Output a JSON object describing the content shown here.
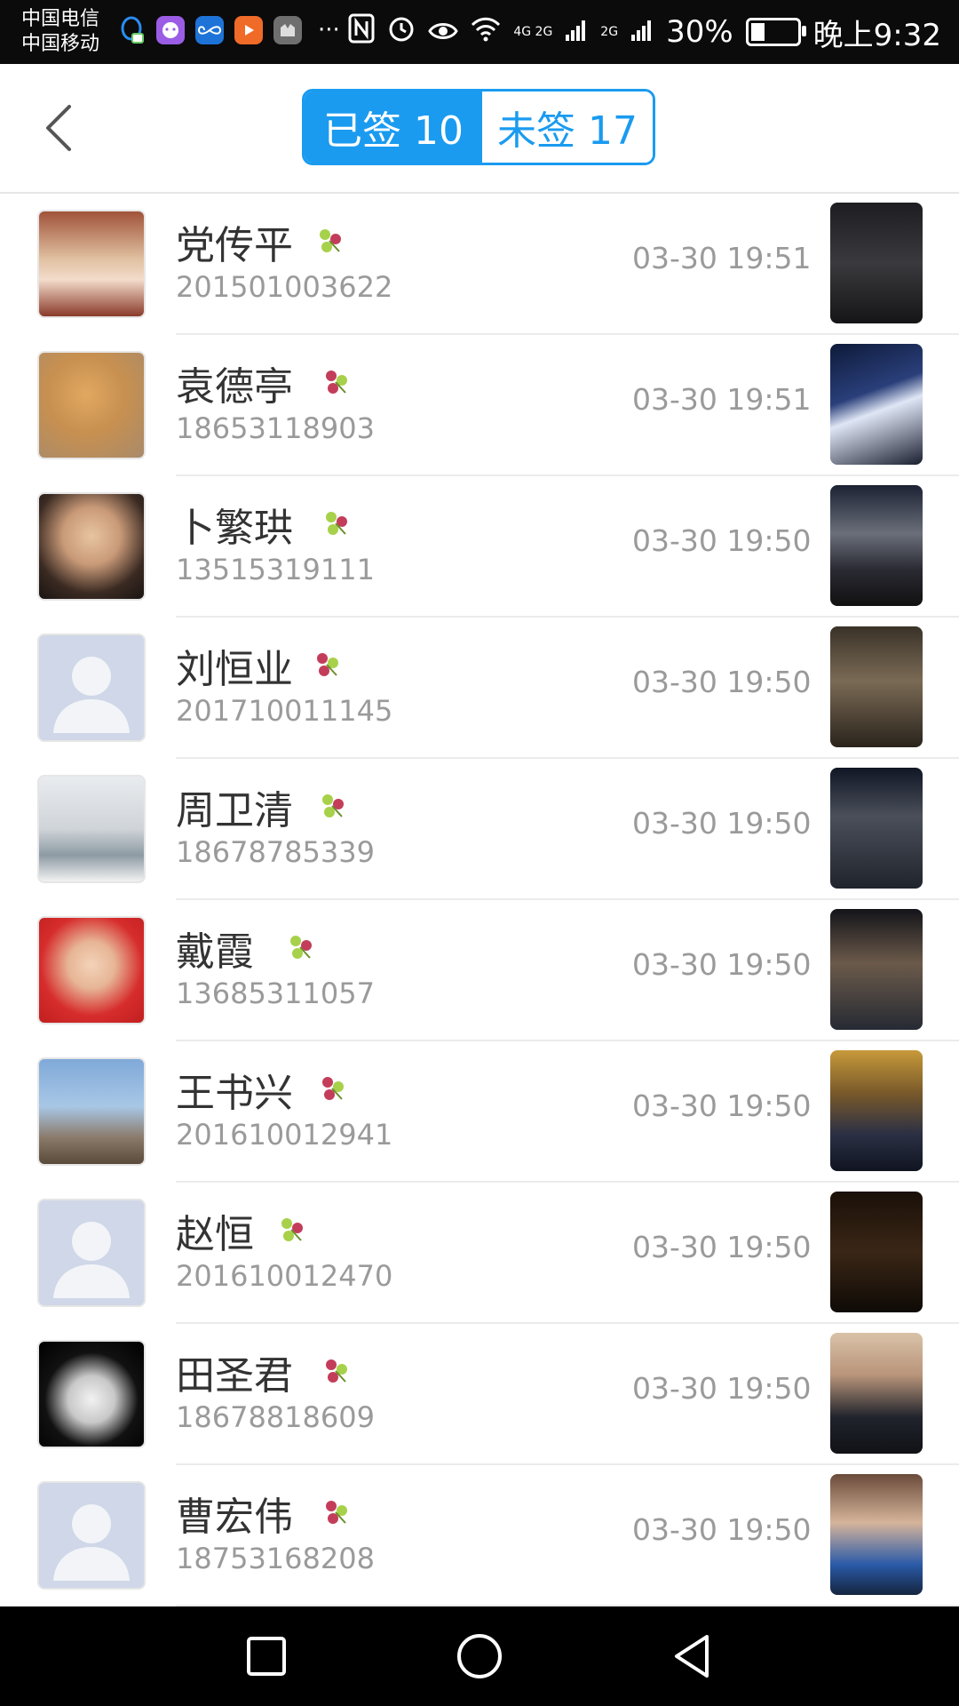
{
  "status_bar": {
    "carrier_1": "中国电信",
    "carrier_2": "中国移动",
    "apps": [
      "qq-icon",
      "messenger-icon",
      "infinity-app-icon",
      "video-app-icon",
      "huawei-app-icon"
    ],
    "more": "···",
    "network_1": "4G 2G",
    "network_2": "2G",
    "battery": "30%",
    "battery_level": 0.3,
    "time": "晚上9:32"
  },
  "header": {
    "back_icon": "chevron-left-icon",
    "tabs": [
      {
        "label": "已签 10",
        "active": true
      },
      {
        "label": "未签 17",
        "active": false
      }
    ],
    "accent_color": "#1a9bf0"
  },
  "records": [
    {
      "name": "党传平",
      "phone": "201501003622",
      "time": "03-30 19:51"
    },
    {
      "name": "袁德亭",
      "phone": "18653118903",
      "time": "03-30 19:51"
    },
    {
      "name": "卜繁珙",
      "phone": "13515319111",
      "time": "03-30 19:50"
    },
    {
      "name": "刘恒业",
      "phone": "201710011145",
      "time": "03-30 19:50"
    },
    {
      "name": "周卫清",
      "phone": "18678785339",
      "time": "03-30 19:50"
    },
    {
      "name": "戴霞",
      "phone": "13685311057",
      "time": "03-30 19:50"
    },
    {
      "name": "王书兴",
      "phone": "201610012941",
      "time": "03-30 19:50"
    },
    {
      "name": "赵恒",
      "phone": "201610012470",
      "time": "03-30 19:50"
    },
    {
      "name": "田圣君",
      "phone": "18678818609",
      "time": "03-30 19:50"
    },
    {
      "name": "曹宏伟",
      "phone": "18753168208",
      "time": "03-30 19:50"
    }
  ],
  "nav_bar": {
    "buttons": [
      "recents-square-icon",
      "home-circle-icon",
      "back-triangle-icon"
    ]
  }
}
